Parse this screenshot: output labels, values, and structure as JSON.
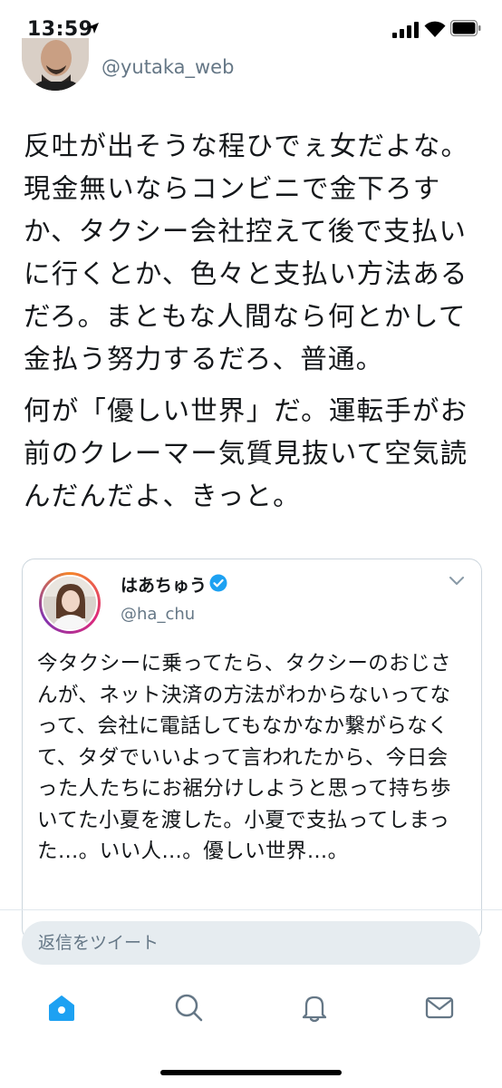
{
  "status_bar": {
    "time": "13:59"
  },
  "author": {
    "handle": "@yutaka_web"
  },
  "tweet": {
    "paragraphs": [
      "反吐が出そうな程ひでぇ女だよな。現金無いならコンビニで金下ろすか、タクシー会社控えて後で支払いに行くとか、色々と支払い方法あるだろ。まともな人間なら何とかして金払う努力するだろ、普通。",
      "何が「優しい世界」だ。運転手がお前のクレーマー気質見抜いて空気読んだんだよ、きっと。"
    ]
  },
  "quoted_tweet": {
    "name": "はあちゅう",
    "handle": "@ha_chu",
    "text": "今タクシーに乗ってたら、タクシーのおじさんが、ネット決済の方法がわからないってなって、会社に電話してもなかなか繋がらなくて、タダでいいよって言われたから、今日会った人たちにお裾分けしようと思って持ち歩いてた小夏を渡した。小夏で支払ってしまった…。いい人…。優しい世界…。"
  },
  "reply": {
    "placeholder": "返信をツイート"
  },
  "tab_bar": {
    "tabs": [
      "home-icon",
      "search-icon",
      "notifications-icon",
      "messages-icon"
    ]
  },
  "colors": {
    "accent": "#1da1f2",
    "muted": "#657786",
    "border": "#ccd6dd"
  }
}
